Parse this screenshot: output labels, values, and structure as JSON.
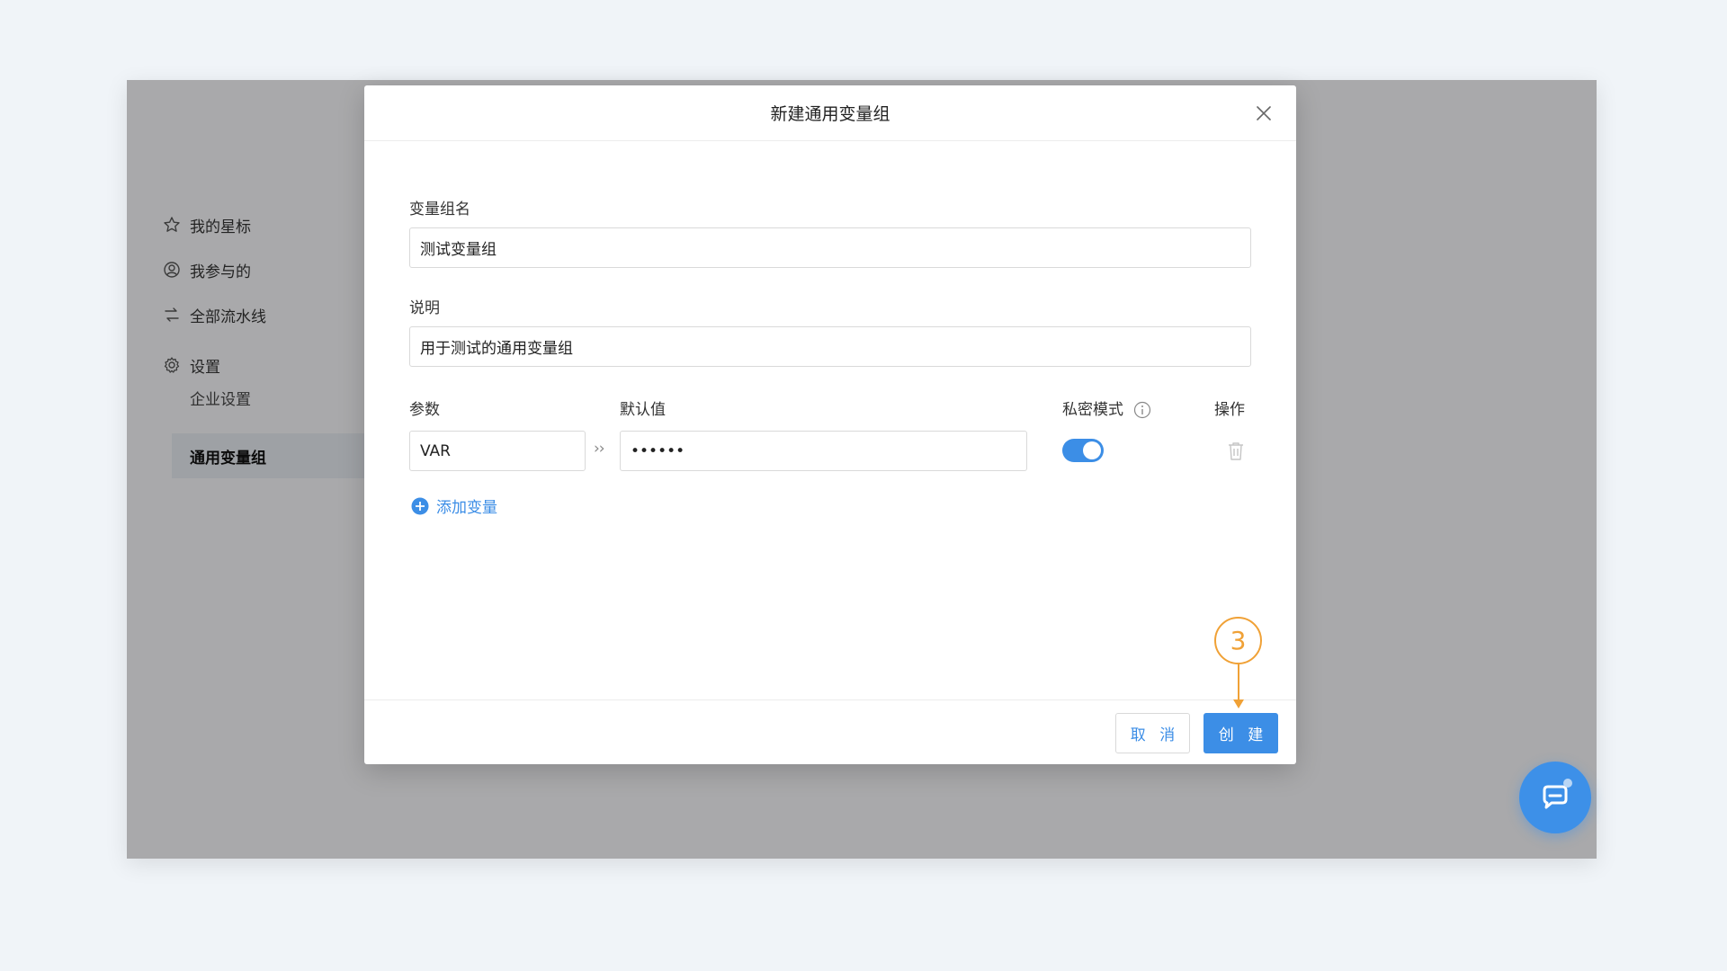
{
  "sidebar": {
    "items": [
      {
        "label": "我的星标",
        "icon": "star-icon"
      },
      {
        "label": "我参与的",
        "icon": "user-circle-icon"
      },
      {
        "label": "全部流水线",
        "icon": "pipeline-icon"
      },
      {
        "label": "设置",
        "icon": "gear-icon"
      }
    ],
    "sub_items": [
      {
        "label": "企业设置",
        "active": false
      },
      {
        "label": "通用变量组",
        "active": true
      }
    ]
  },
  "modal": {
    "title": "新建通用变量组",
    "name_label": "变量组名",
    "name_value": "测试变量组",
    "desc_label": "说明",
    "desc_value": "用于测试的通用变量组",
    "columns": {
      "param": "参数",
      "default": "默认值",
      "private": "私密模式",
      "action": "操作"
    },
    "variables": [
      {
        "param": "VAR",
        "default": "••••••",
        "private": true
      }
    ],
    "add_variable_label": "添加变量",
    "cancel_label": "取 消",
    "create_label": "创 建",
    "separator": "››"
  },
  "annotation": {
    "step": "3"
  },
  "colors": {
    "accent": "#3c8ee6",
    "annotation": "#f0a136"
  }
}
